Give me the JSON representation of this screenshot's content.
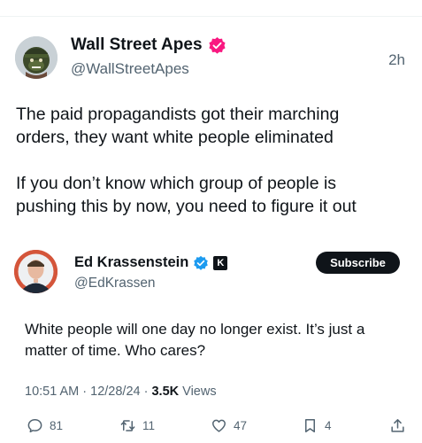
{
  "tweet": {
    "author_name": "Wall Street Apes",
    "author_handle": "@WallStreetApes",
    "time": "2h",
    "text_lines": [
      "The paid propagandists got their marching",
      "orders, they want white people eliminated",
      "If you don’t know which group of people is",
      "pushing this by now, you need to figure it out"
    ],
    "badge_color": "#f91880",
    "badge_icon": "verified-badge-icon"
  },
  "quote": {
    "author_name": "Ed Krassenstein",
    "author_handle": "@EdKrassen",
    "subscribe_label": "Subscribe",
    "badge_color": "#1d9bf0",
    "affiliate_glyph": "K",
    "text_lines": [
      "White people will one day no longer exist. It’s just a",
      "matter of time. Who cares?"
    ],
    "meta_prefix": "10:51 AM · 12/28/24 · ",
    "views_count": "3.5K",
    "views_label": " Views"
  },
  "actions": {
    "replies": "81",
    "reposts": "11",
    "likes": "47",
    "bookmarks": "4"
  }
}
